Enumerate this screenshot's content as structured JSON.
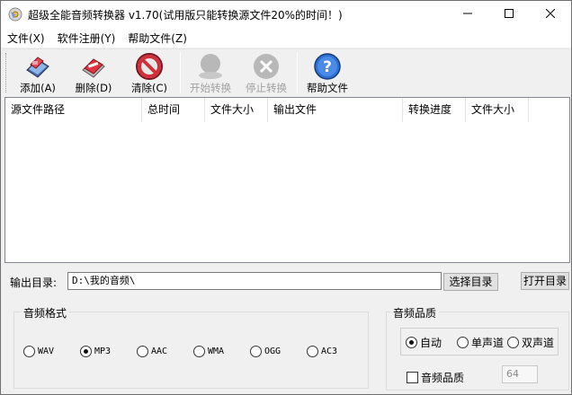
{
  "window": {
    "title": "超级全能音频转换器 v1.70(试用版只能转换源文件20%的时间！)",
    "controls": {
      "minimize": "minimize-icon",
      "maximize": "maximize-icon",
      "close": "close-icon"
    }
  },
  "menu": {
    "items": [
      {
        "label": "文件(X)"
      },
      {
        "label": "软件注册(Y)"
      },
      {
        "label": "帮助文件(Z)"
      }
    ]
  },
  "toolbar": {
    "add": {
      "label": "添加(A)",
      "icon": "add-file-icon",
      "enabled": true
    },
    "delete": {
      "label": "删除(D)",
      "icon": "delete-file-icon",
      "enabled": true
    },
    "clear": {
      "label": "清除(C)",
      "icon": "clear-icon",
      "enabled": true
    },
    "start": {
      "label": "开始转换",
      "icon": "start-convert-icon",
      "enabled": false
    },
    "stop": {
      "label": "停止转换",
      "icon": "stop-convert-icon",
      "enabled": false
    },
    "help": {
      "label": "帮助文件",
      "icon": "help-icon",
      "enabled": true
    }
  },
  "file_list": {
    "columns": [
      "源文件路径",
      "总时间",
      "文件大小",
      "输出文件",
      "转换进度",
      "文件大小"
    ],
    "rows": []
  },
  "output": {
    "label": "输出目录:",
    "value": "D:\\我的音频\\",
    "select_button": "选择目录",
    "open_button": "打开目录"
  },
  "format_group": {
    "label": "音频格式",
    "options": [
      "WAV",
      "MP3",
      "AAC",
      "WMA",
      "OGG",
      "AC3"
    ],
    "selected": "MP3"
  },
  "quality_group": {
    "label": "音频品质",
    "options": [
      "自动",
      "单声道",
      "双声道"
    ],
    "selected": "自动",
    "checkbox_label": "音频品质",
    "checkbox_checked": false,
    "quality_value": "64"
  },
  "colors": {
    "accent_red": "#d0303a",
    "help_blue": "#2f6fd0",
    "disabled_gray": "#a0a0a0"
  }
}
